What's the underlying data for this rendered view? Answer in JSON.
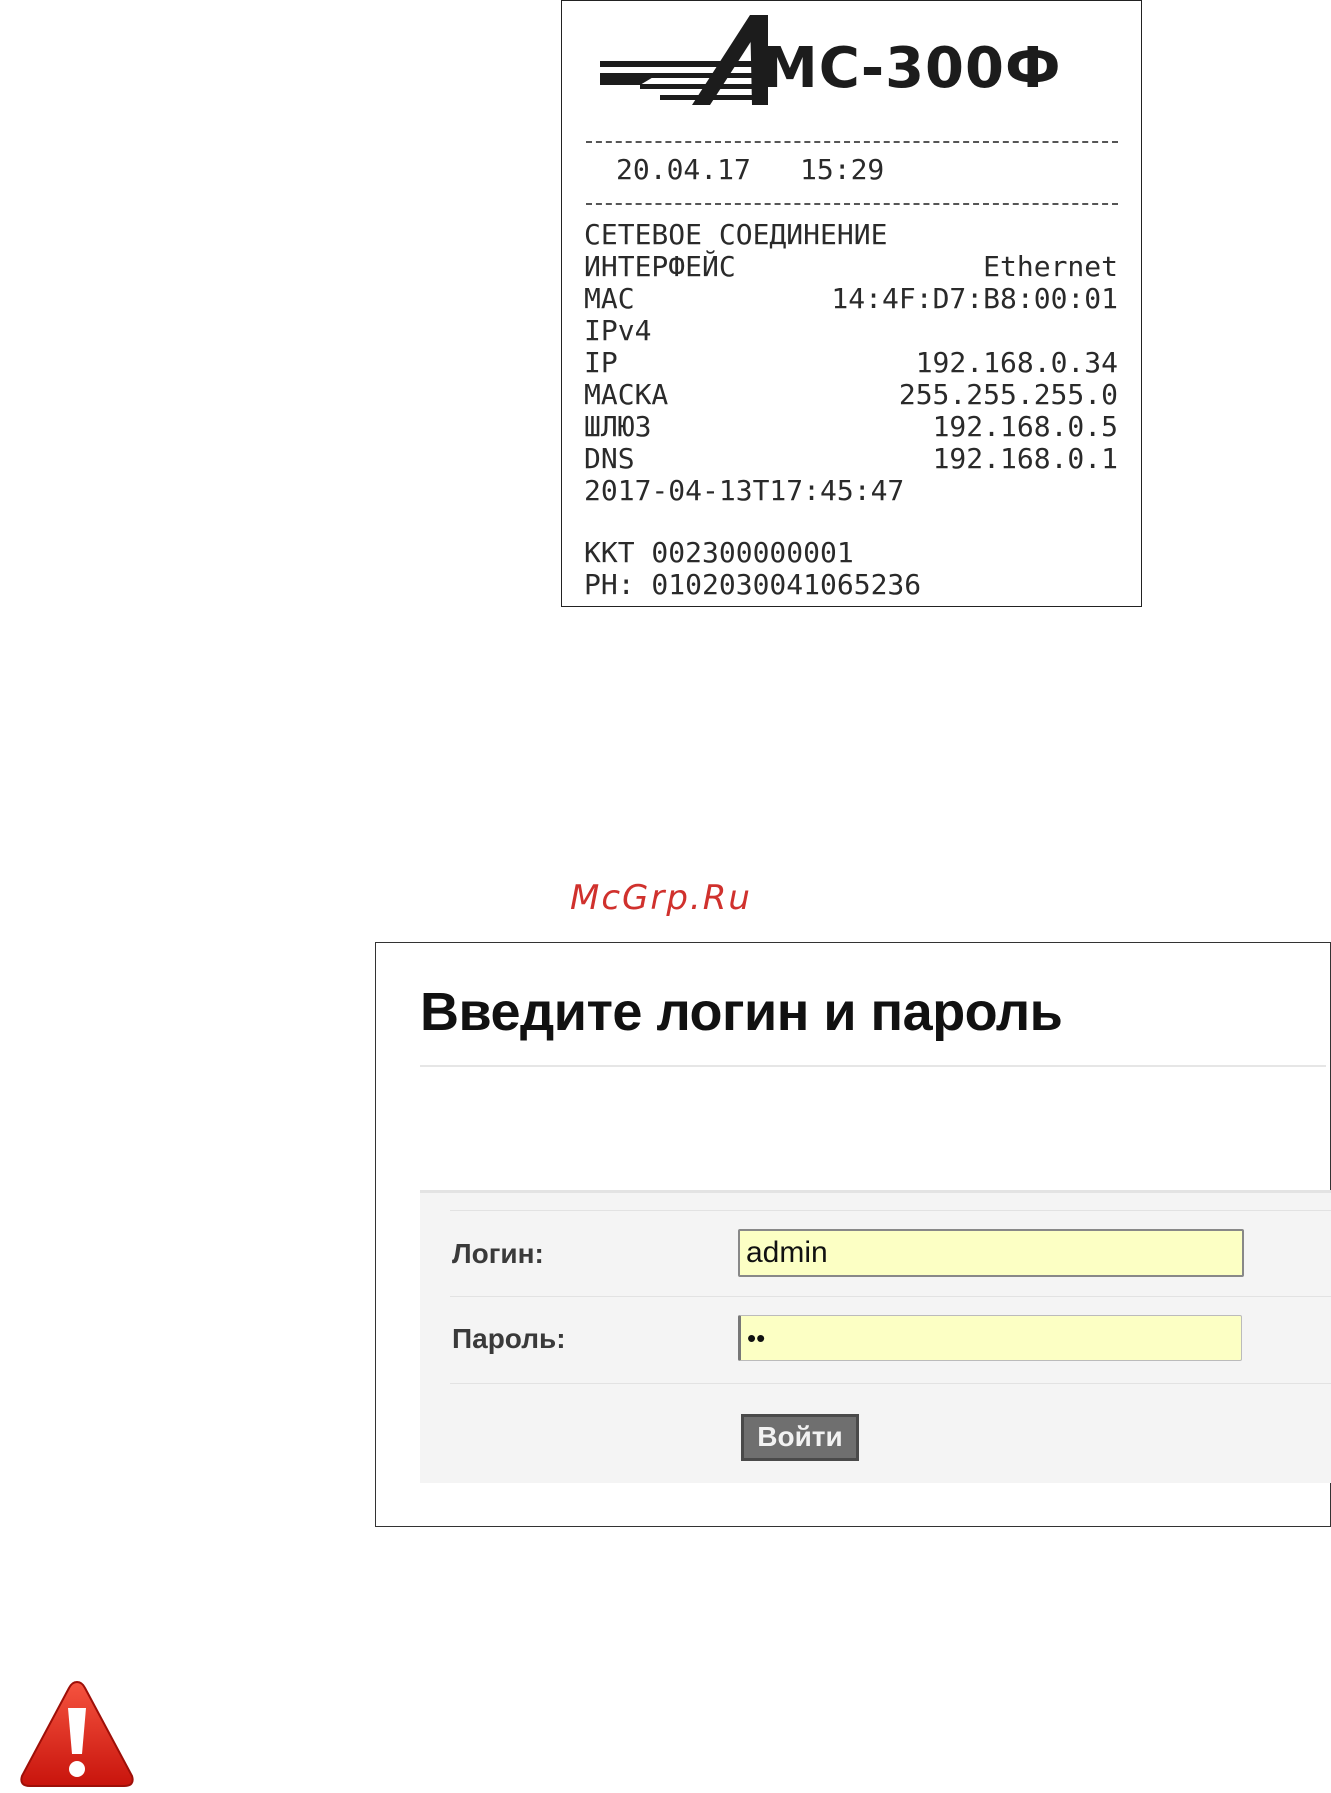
{
  "receipt": {
    "logo_text": "МС-300Ф",
    "date": "20.04.17",
    "time": "15:29",
    "section_title": "СЕТЕВОЕ СОЕДИНЕНИЕ",
    "rows": [
      {
        "label": "ИНТЕРФЕЙС",
        "value": "Ethernet"
      },
      {
        "label": "MAC",
        "value": "14:4F:D7:B8:00:01"
      },
      {
        "label": "IPv4",
        "value": ""
      },
      {
        "label": "IP",
        "value": "192.168.0.34"
      },
      {
        "label": "МАСКА",
        "value": "255.255.255.0"
      },
      {
        "label": "ШЛЮЗ",
        "value": "192.168.0.5"
      },
      {
        "label": "DNS",
        "value": "192.168.0.1"
      }
    ],
    "timestamp": "2017-04-13T17:45:47",
    "kkt": "ККТ 002300000001",
    "rn": "РН: 0102030041065236"
  },
  "watermark": "McGrp.Ru",
  "login": {
    "title": "Введите логин и пароль",
    "login_label": "Логин:",
    "login_value": "admin",
    "password_label": "Пароль:",
    "password_value": "••",
    "submit_label": "Войти"
  },
  "colors": {
    "watermark": "#d0312d",
    "input_bg": "#fcffc4",
    "button_bg": "#6f6f6f",
    "warning_red": "#e2231a"
  },
  "icons": {
    "warning": "warning-triangle-icon"
  }
}
